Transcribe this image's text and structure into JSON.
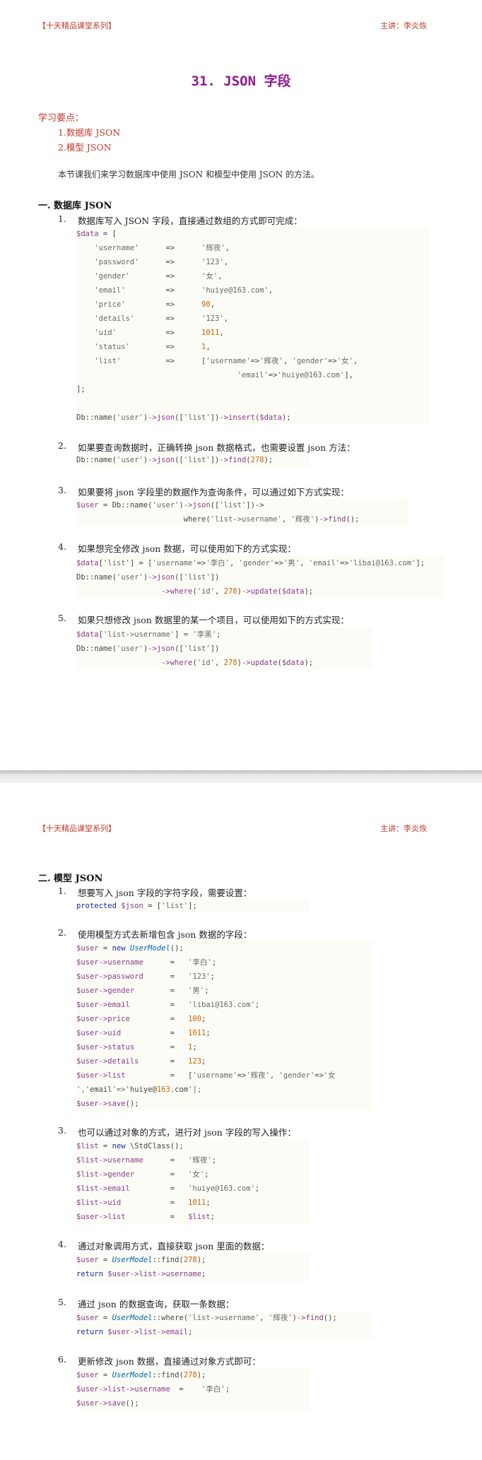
{
  "header": {
    "left": "【十天精品课堂系列】",
    "right": "主讲：李炎恢"
  },
  "title": "31. JSON 字段",
  "keypoints": {
    "title": "学习要点：",
    "items": [
      "1.数据库 JSON",
      "2.模型 JSON"
    ]
  },
  "intro": "本节课我们来学习数据库中使用 JSON 和模型中使用 JSON 的方法。",
  "section1": {
    "title": "一. 数据库 JSON",
    "items": [
      {
        "num": "1.",
        "text": "数据库写入 JSON 字段，直接通过数组的方式即可完成："
      },
      {
        "num": "2.",
        "text": "如果要查询数据时，正确转换 json 数据格式，也需要设置 json 方法："
      },
      {
        "num": "3.",
        "text": "如果要将 json 字段里的数据作为查询条件，可以通过如下方式实现："
      },
      {
        "num": "4.",
        "text": "如果想完全修改 json 数据，可以使用如下的方式实现："
      },
      {
        "num": "5.",
        "text": "如果只想修改 json 数据里的某一个项目，可以使用如下的方式实现："
      }
    ]
  },
  "section2": {
    "title": "二. 模型 JSON",
    "items": [
      {
        "num": "1.",
        "text": "想要写入 json 字段的字符字段，需要设置："
      },
      {
        "num": "2.",
        "text": "使用模型方式去新增包含 json 数据的字段："
      },
      {
        "num": "3.",
        "text": "也可以通过对象的方式，进行对 json 字段的写入操作："
      },
      {
        "num": "4.",
        "text": "通过对象调用方式，直接获取 json 里面的数据："
      },
      {
        "num": "5.",
        "text": "通过 json 的数据查询，获取一条数据："
      },
      {
        "num": "6.",
        "text": "更新修改 json 数据，直接通过对象方式即可："
      }
    ]
  },
  "code": {
    "s1c1": [
      "$data = [",
      "    'username'      =>      '辉夜',",
      "    'password'      =>      '123',",
      "    'gender'        =>      '女',",
      "    'email'         =>      'huiye@163.com',",
      "    'price'         =>      90,",
      "    'details'       =>      '123',",
      "    'uid'           =>      1011,",
      "    'status'        =>      1,",
      "    'list'          =>      ['username'=>'辉夜', 'gender'=>'女',",
      "                                    'email'=>'huiye@163.com'],",
      "];",
      "",
      "Db::name('user')->json(['list'])->insert($data);"
    ],
    "s1c2": [
      "Db::name('user')->json(['list'])->find(278);"
    ],
    "s1c3": [
      "$user = Db::name('user')->json(['list'])->",
      "                        where('list->username', '辉夜')->find();"
    ],
    "s1c4": [
      "$data['list'] = ['username'=>'李白', 'gender'=>'男', 'email'=>'libai@163.com'];",
      "Db::name('user')->json(['list'])",
      "                   ->where('id', 278)->update($data);"
    ],
    "s1c5": [
      "$data['list->username'] = '李黑';",
      "Db::name('user')->json(['list'])",
      "                   ->where('id', 278)->update($data);"
    ],
    "s2c1": [
      "protected $json = ['list'];"
    ],
    "s2c2": [
      "$user = new UserModel();",
      "$user->username      =   '李白';",
      "$user->password      =   '123';",
      "$user->gender        =   '男';",
      "$user->email         =   'libai@163.com';",
      "$user->price         =   100;",
      "$user->uid           =   1011;",
      "$user->status        =   1;",
      "$user->details       =   123;",
      "$user->list          =   ['username'=>'辉夜', 'gender'=>'女",
      "','email'=>'huiye@163.com'];",
      "$user->save();"
    ],
    "s2c3": [
      "$list = new \\StdClass();",
      "$list->username      =   '辉夜';",
      "$list->gender        =   '女';",
      "$list->email         =   'huiye@163.com';",
      "$list->uid           =   1011;",
      "$user->list          =   $list;"
    ],
    "s2c4": [
      "$user = UserModel::find(278);",
      "return $user->list->username;"
    ],
    "s2c5": [
      "$user = UserModel::where('list->username', '辉夜')->find();",
      "return $user->list->email;"
    ],
    "s2c6": [
      "$user = UserModel::find(278);",
      "$user->list->username  =    '李白';",
      "$user->save();"
    ]
  }
}
